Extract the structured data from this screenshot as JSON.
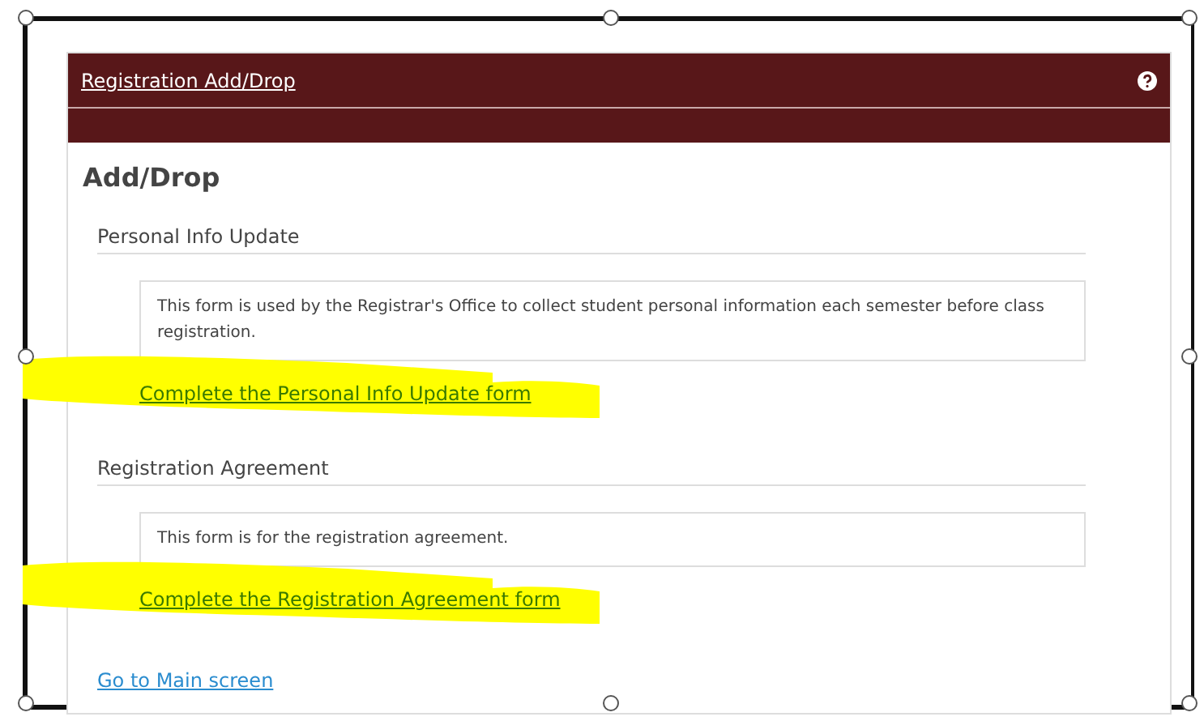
{
  "panel": {
    "title": "Registration Add/Drop"
  },
  "heading": "Add/Drop",
  "sections": [
    {
      "title": "Personal Info Update",
      "description": "This form is used by the Registrar's Office to collect student personal information each semester before class registration.",
      "link": "Complete the Personal Info Update form",
      "highlighted": true
    },
    {
      "title": "Registration Agreement",
      "description": "This form is for the registration agreement.",
      "link": "Complete the Registration Agreement form",
      "highlighted": true
    }
  ],
  "main_link": "Go to Main screen"
}
